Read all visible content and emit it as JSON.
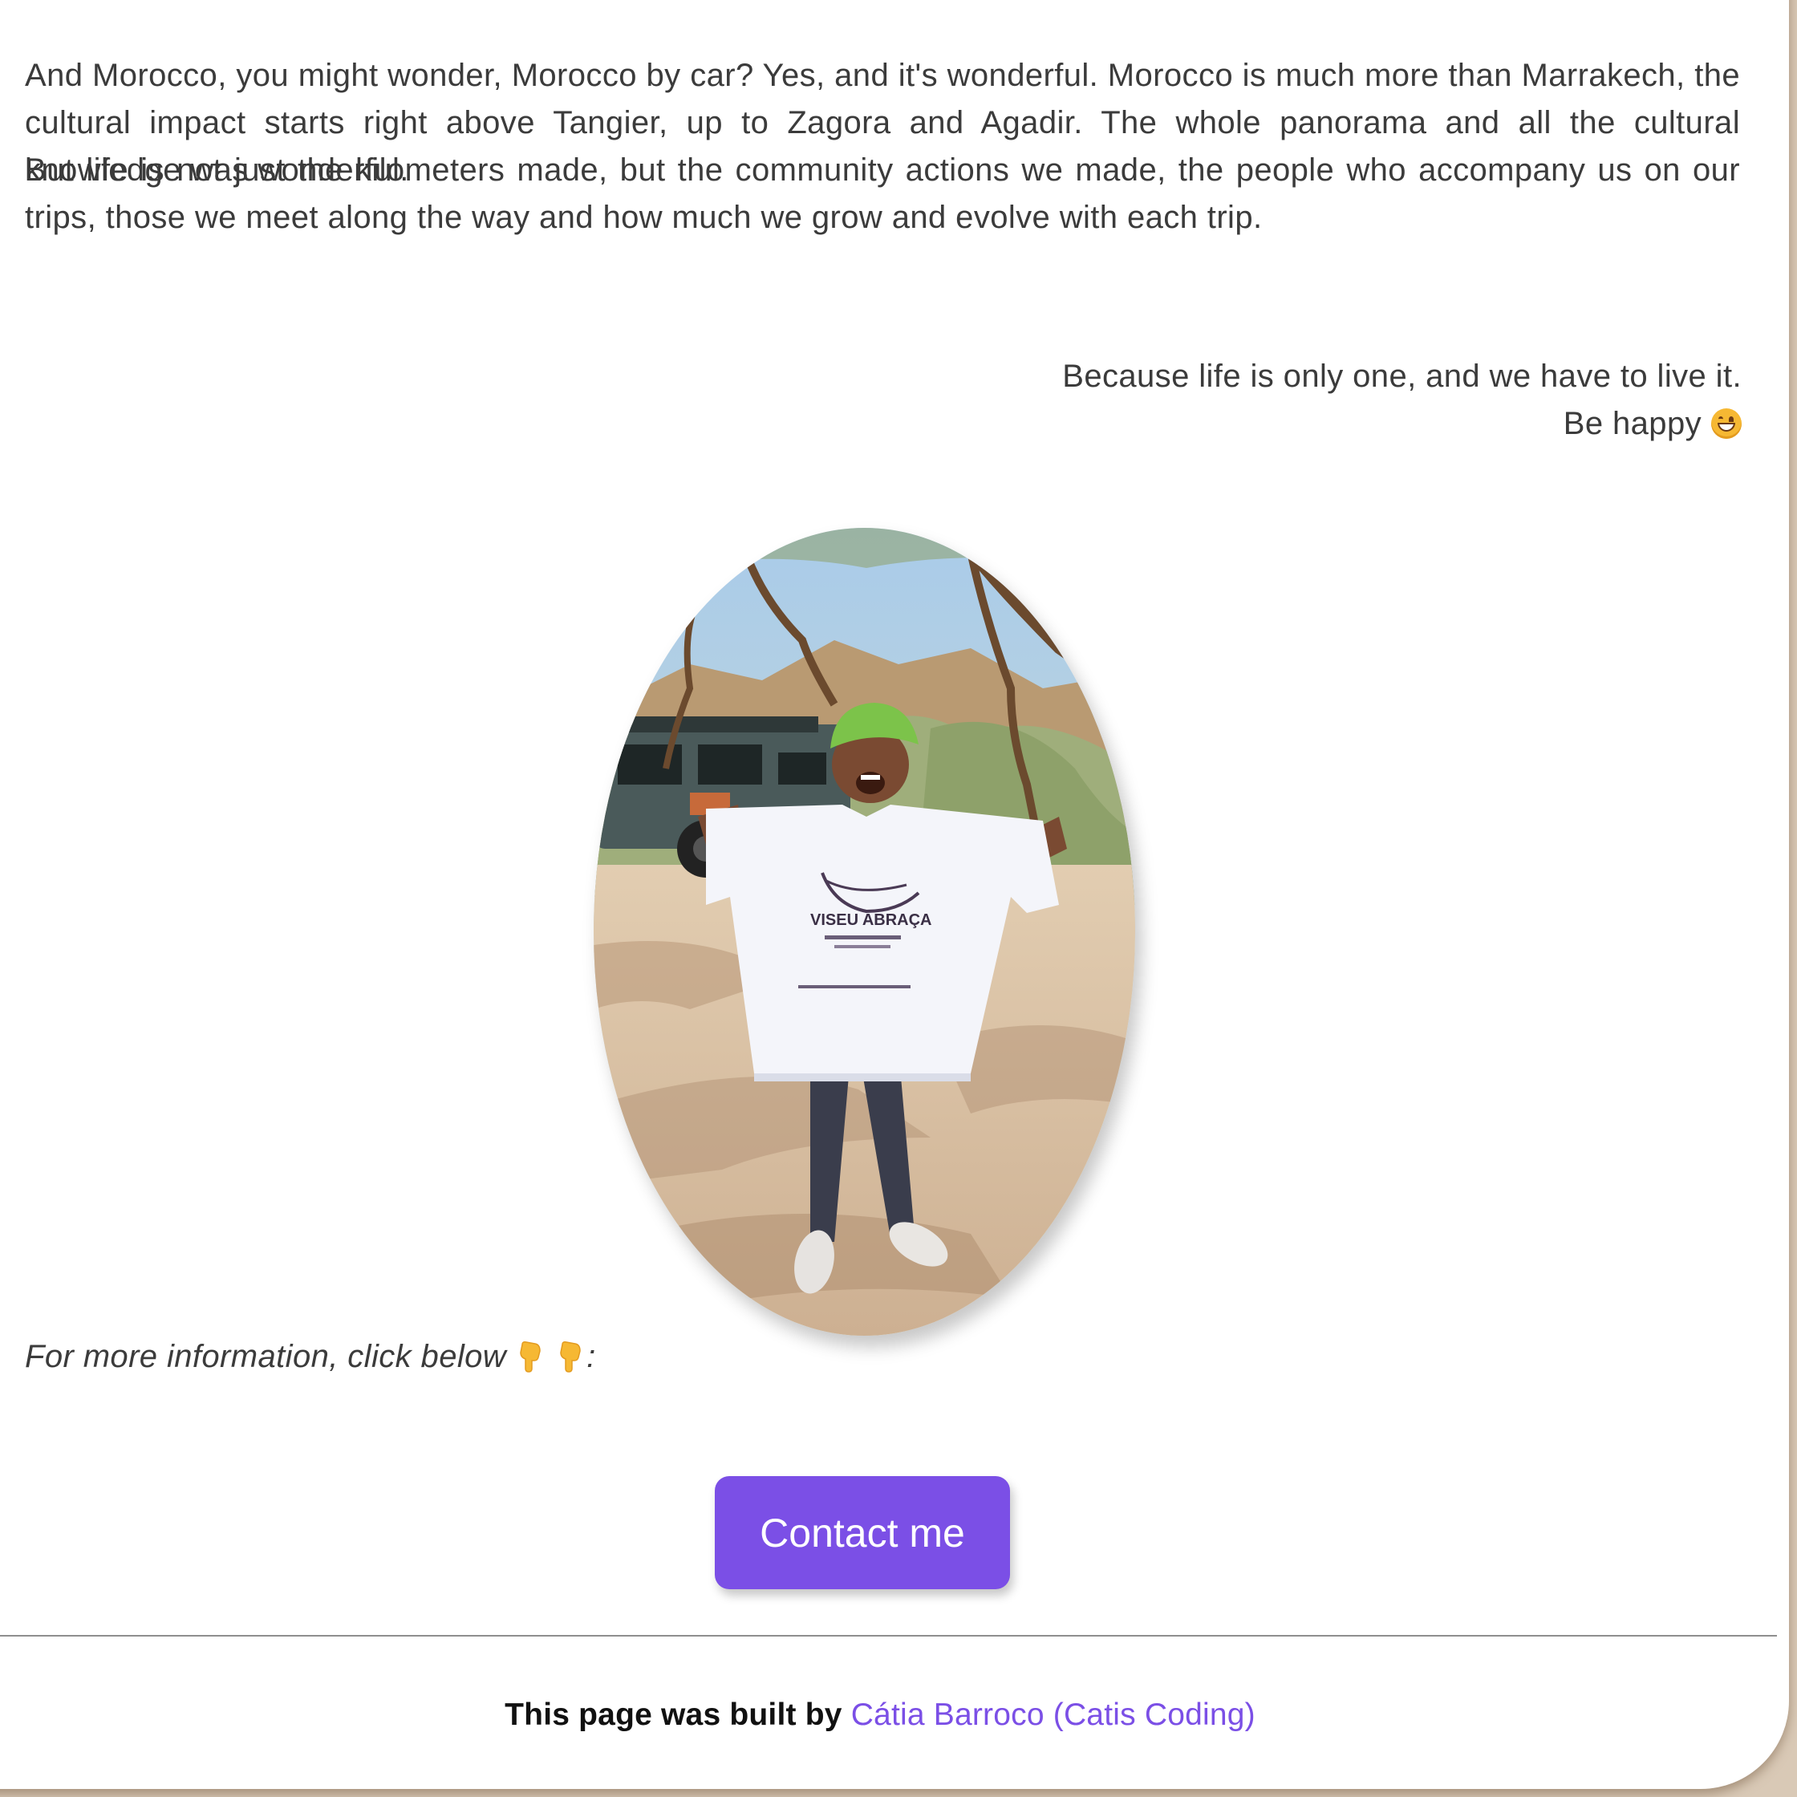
{
  "article": {
    "paragraph_1": "And Morocco, you might wonder, Morocco by car? Yes, and it's wonderful. Morocco is much more than Marrakech, the cultural impact starts right above Tangier, up to Zagora and Agadir. The whole panorama and all the cultural knowledge was wonderful.",
    "paragraph_2": "But life is not just the kilometers made, but the community actions we made, the people who accompany us on our trips, those we meet along the way and how much we grow and evolve with each trip.",
    "closing_line_1": "Because life is only one, and we have to live it.",
    "closing_line_2": "Be happy",
    "closing_emoji": "grinning-face-icon"
  },
  "photo": {
    "shirt_text": "VISEU ABRAÇA"
  },
  "cta": {
    "info_text": "For more information, click below",
    "info_suffix": ":",
    "button_label": "Contact me",
    "button_color": "#7b4fe6"
  },
  "footer": {
    "prefix": "This page was built by",
    "author_link": "Cátia Barroco (Catis Coding)"
  },
  "colors": {
    "background": "#d9c9b6",
    "card": "#ffffff",
    "text": "#3b3b3b",
    "accent": "#7b4fe6"
  }
}
